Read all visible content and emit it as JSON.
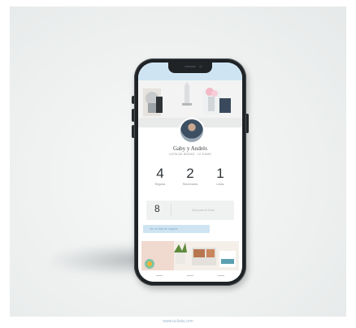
{
  "profile": {
    "name": "Gaby y Andrés",
    "subtitle": "LISTA DE BODAS · 12 JUNIO"
  },
  "stats": [
    {
      "value": "4",
      "label": "Regalos"
    },
    {
      "value": "2",
      "label": "Reservados"
    },
    {
      "value": "1",
      "label": "Listas"
    }
  ],
  "card": {
    "value": "8",
    "label": "Días para la boda"
  },
  "cta": {
    "label": "Ver mi lista de regalos"
  },
  "footer": {
    "url": "www.tu-lista.com"
  },
  "colors": {
    "accent": "#cfe4f3",
    "phone_frame": "#1f2326",
    "text_dark": "#2f3336"
  }
}
